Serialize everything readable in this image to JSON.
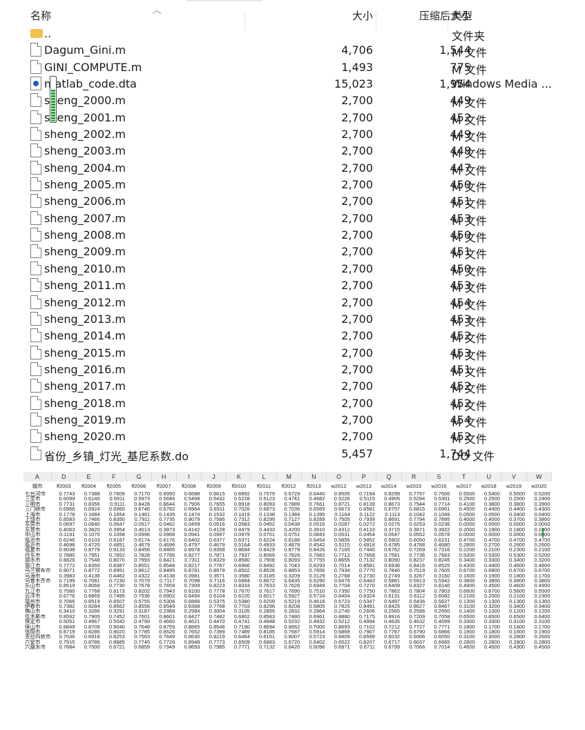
{
  "explorer": {
    "columns": {
      "name": "名称",
      "size": "大小",
      "compressed": "压缩后大小",
      "type": "类型"
    },
    "files": [
      {
        "name": "..",
        "size": "",
        "compressed": "",
        "type": "文件夹",
        "icon": "folder-icon"
      },
      {
        "name": "Dagum_Gini.m",
        "size": "4,706",
        "compressed": "1,544",
        "type": "M 文件",
        "icon": "document-icon"
      },
      {
        "name": "GINI_COMPUTE.m",
        "size": "1,493",
        "compressed": "775",
        "type": "M 文件",
        "icon": "document-icon"
      },
      {
        "name": "matlab_code.dta",
        "size": "15,023",
        "compressed": "1,954",
        "type": "Windows Media ...",
        "icon": "dta-file-icon"
      },
      {
        "name": "sheng_2000.m",
        "size": "2,700",
        "compressed": "449",
        "type": "M 文件",
        "icon": "document-icon"
      },
      {
        "name": "sheng_2001.m",
        "size": "2,700",
        "compressed": "452",
        "type": "M 文件",
        "icon": "document-icon"
      },
      {
        "name": "sheng_2002.m",
        "size": "2,700",
        "compressed": "449",
        "type": "M 文件",
        "icon": "document-icon"
      },
      {
        "name": "sheng_2003.m",
        "size": "2,700",
        "compressed": "448",
        "type": "M 文件",
        "icon": "document-icon"
      },
      {
        "name": "sheng_2004.m",
        "size": "2,700",
        "compressed": "447",
        "type": "M 文件",
        "icon": "document-icon"
      },
      {
        "name": "sheng_2005.m",
        "size": "2,700",
        "compressed": "450",
        "type": "M 文件",
        "icon": "document-icon"
      },
      {
        "name": "sheng_2006.m",
        "size": "2,700",
        "compressed": "451",
        "type": "M 文件",
        "icon": "document-icon"
      },
      {
        "name": "sheng_2007.m",
        "size": "2,700",
        "compressed": "453",
        "type": "M 文件",
        "icon": "document-icon"
      },
      {
        "name": "sheng_2008.m",
        "size": "2,700",
        "compressed": "450",
        "type": "M 文件",
        "icon": "document-icon"
      },
      {
        "name": "sheng_2009.m",
        "size": "2,700",
        "compressed": "451",
        "type": "M 文件",
        "icon": "document-icon"
      },
      {
        "name": "sheng_2010.m",
        "size": "2,700",
        "compressed": "450",
        "type": "M 文件",
        "icon": "document-icon"
      },
      {
        "name": "sheng_2011.m",
        "size": "2,700",
        "compressed": "453",
        "type": "M 文件",
        "icon": "document-icon"
      },
      {
        "name": "sheng_2012.m",
        "size": "2,700",
        "compressed": "454",
        "type": "M 文件",
        "icon": "document-icon"
      },
      {
        "name": "sheng_2013.m",
        "size": "2,700",
        "compressed": "453",
        "type": "M 文件",
        "icon": "document-icon"
      },
      {
        "name": "sheng_2014.m",
        "size": "2,700",
        "compressed": "452",
        "type": "M 文件",
        "icon": "document-icon"
      },
      {
        "name": "sheng_2015.m",
        "size": "2,700",
        "compressed": "453",
        "type": "M 文件",
        "icon": "document-icon"
      },
      {
        "name": "sheng_2016.m",
        "size": "2,700",
        "compressed": "451",
        "type": "M 文件",
        "icon": "document-icon"
      },
      {
        "name": "sheng_2017.m",
        "size": "2,700",
        "compressed": "452",
        "type": "M 文件",
        "icon": "document-icon"
      },
      {
        "name": "sheng_2018.m",
        "size": "2,700",
        "compressed": "452",
        "type": "M 文件",
        "icon": "document-icon"
      },
      {
        "name": "sheng_2019.m",
        "size": "2,700",
        "compressed": "454",
        "type": "M 文件",
        "icon": "document-icon"
      },
      {
        "name": "sheng_2020.m",
        "size": "2,700",
        "compressed": "452",
        "type": "M 文件",
        "icon": "document-icon"
      },
      {
        "name": "省份_乡镇_灯光_基尼系数.do",
        "size": "5,457",
        "compressed": "1,744",
        "type": "DO 文件",
        "icon": "document-icon"
      }
    ]
  },
  "spreadsheet": {
    "column_letters": [
      "A",
      "D",
      "E",
      "F",
      "G",
      "H",
      "I",
      "J",
      "K",
      "L",
      "M",
      "N",
      "O",
      "P",
      "Q",
      "R",
      "S",
      "T",
      "U",
      "V",
      "W"
    ],
    "field_names": [
      "城市",
      "ff2003",
      "ff2004",
      "ff2005",
      "ff2006",
      "ff2007",
      "ff2008",
      "ff2009",
      "ff2010",
      "ff2011",
      "ff2012",
      "ff2013",
      "w2012",
      "w2013",
      "w2014",
      "w2015",
      "w2016",
      "w2017",
      "w2018",
      "w2019",
      "w2020"
    ],
    "rows": [
      [
        "七台河市",
        "0.7743",
        "0.7388",
        "0.7609",
        "0.7170",
        "0.6950",
        "0.6688",
        "0.6615",
        "0.6892",
        "0.7079",
        "0.6729",
        "0.6440",
        "0.8505",
        "0.7194",
        "0.8299",
        "0.7797",
        "0.7606",
        "0.5500",
        "0.5400",
        "0.5500",
        "0.5200"
      ],
      [
        "三亚市",
        "0.6099",
        "0.6140",
        "0.5911",
        "0.5973",
        "0.5646",
        "0.5468",
        "0.5432",
        "0.5228",
        "0.5123",
        "0.4741",
        "0.4682",
        "0.5226",
        "0.5115",
        "0.4905",
        "0.5294",
        "0.5301",
        "0.2500",
        "0.2500",
        "0.2500",
        "0.2400"
      ],
      [
        "三明市",
        "0.7731",
        "0.8356",
        "0.9111",
        "0.8428",
        "0.8644",
        "0.7906",
        "0.7655",
        "0.8918",
        "0.8093",
        "0.7889",
        "0.7661",
        "0.8721",
        "0.8139",
        "0.8673",
        "0.7544",
        "0.7714",
        "0.4100",
        "0.3800",
        "0.3800",
        "0.3900"
      ],
      [
        "三门峡市",
        "0.6966",
        "0.6924",
        "0.6960",
        "0.6746",
        "0.6782",
        "0.6964",
        "0.6911",
        "0.7026",
        "0.6873",
        "0.7036",
        "0.6565",
        "0.6673",
        "0.6581",
        "0.6757",
        "0.6815",
        "0.6901",
        "0.4500",
        "0.4400",
        "0.4400",
        "0.4300"
      ],
      [
        "上海市",
        "0.1778",
        "0.1684",
        "0.1654",
        "0.1461",
        "0.1435",
        "0.1474",
        "0.1532",
        "0.1419",
        "0.1338",
        "0.1384",
        "0.1395",
        "0.1164",
        "0.1122",
        "0.1113",
        "0.1042",
        "0.1049",
        "0.0500",
        "0.0500",
        "0.0400",
        "0.0400"
      ],
      [
        "上饶市",
        "0.8583",
        "0.7466",
        "0.8350",
        "0.7911",
        "0.7735",
        "0.8079",
        "0.7586",
        "0.7312",
        "0.8299",
        "0.7127",
        "0.8289",
        "0.7505",
        "0.7939",
        "0.8691",
        "0.7794",
        "0.7895",
        "0.4000",
        "0.4000",
        "0.3700",
        "0.3800"
      ],
      [
        "东莞市",
        "0.0697",
        "0.0640",
        "0.0647",
        "0.0517",
        "0.0462",
        "0.0459",
        "0.0516",
        "0.0583",
        "0.0452",
        "0.0438",
        "0.0516",
        "0.0287",
        "0.0272",
        "0.0275",
        "0.0253",
        "0.0236",
        "0.0000",
        "0.0000",
        "0.0000",
        "0.0000"
      ],
      [
        "东营市",
        "0.4063",
        "0.3820",
        "0.3954",
        "0.4013",
        "0.3873",
        "0.4142",
        "0.4128",
        "0.4479",
        "0.4433",
        "0.4200",
        "0.3910",
        "0.4312",
        "0.4133",
        "0.3715",
        "0.3871",
        "0.3922",
        "0.2000",
        "0.1900",
        "0.1800",
        "0.1800"
      ],
      [
        "中山市",
        "0.1191",
        "0.1070",
        "0.1058",
        "0.0996",
        "0.0968",
        "0.0941",
        "0.0997",
        "0.0979",
        "0.0701",
        "0.0751",
        "0.0843",
        "0.0531",
        "0.0454",
        "0.0547",
        "0.0552",
        "0.0578",
        "0.0000",
        "0.0000",
        "0.0000",
        "0.0000"
      ],
      [
        "临沧市",
        "0.6246",
        "0.6103",
        "0.6187",
        "0.6174",
        "0.6176",
        "0.6402",
        "0.6377",
        "0.6371",
        "0.6224",
        "0.6186",
        "0.6454",
        "0.5856",
        "0.5852",
        "0.5902",
        "0.6050",
        "0.6231",
        "0.4700",
        "0.4700",
        "0.4700",
        "0.4700"
      ],
      [
        "临沂市",
        "0.4698",
        "0.4720",
        "0.4851",
        "0.4679",
        "0.4696",
        "0.4797",
        "0.4679",
        "0.5164",
        "0.4933",
        "0.4878",
        "0.4542",
        "0.5115",
        "0.4918",
        "0.4785",
        "0.4788",
        "0.4680",
        "0.2800",
        "0.2700",
        "0.2600",
        "0.2600"
      ],
      [
        "临夏市",
        "0.9038",
        "0.8778",
        "0.9133",
        "0.8456",
        "0.8485",
        "0.8978",
        "0.8358",
        "0.8694",
        "0.8429",
        "0.8779",
        "0.8426",
        "0.7165",
        "0.7445",
        "0.6762",
        "0.7269",
        "0.7316",
        "0.2200",
        "0.2100",
        "0.2300",
        "0.2100"
      ],
      [
        "丹东市",
        "0.7880",
        "0.7951",
        "0.7852",
        "0.7828",
        "0.7785",
        "0.8277",
        "0.7871",
        "0.7937",
        "0.8069",
        "0.7826",
        "0.7682",
        "0.7712",
        "0.7658",
        "0.7581",
        "0.7736",
        "0.7663",
        "0.5300",
        "0.5300",
        "0.5300",
        "0.5200"
      ],
      [
        "丽水市",
        "0.8826",
        "0.7548",
        "0.8070",
        "0.7993",
        "0.8421",
        "0.7311",
        "0.8329",
        "0.8580",
        "0.7908",
        "0.8093",
        "0.7755",
        "0.8655",
        "0.7132",
        "0.8090",
        "0.8237",
        "0.8245",
        "0.3400",
        "0.3300",
        "0.3400",
        "0.3200"
      ],
      [
        "丽江市",
        "0.7772",
        "0.8350",
        "0.8387",
        "0.8551",
        "0.8548",
        "0.8217",
        "0.7787",
        "0.6966",
        "0.8492",
        "0.7043",
        "0.8293",
        "0.7014",
        "0.8581",
        "0.6936",
        "0.8416",
        "0.8525",
        "0.4300",
        "0.4400",
        "0.4600",
        "0.4800"
      ],
      [
        "乌兰察布市",
        "0.9071",
        "0.8772",
        "0.8951",
        "0.8612",
        "0.8485",
        "0.8781",
        "0.8979",
        "0.8502",
        "0.8526",
        "0.8853",
        "0.7656",
        "0.7934",
        "0.7770",
        "0.7846",
        "0.7519",
        "0.7605",
        "0.6700",
        "0.6800",
        "0.6700",
        "0.6700"
      ],
      [
        "乌海市",
        "0.3983",
        "0.4136",
        "0.4462",
        "0.4322",
        "0.4138",
        "0.3981",
        "0.3571",
        "0.3580",
        "0.3185",
        "0.3209",
        "0.3129",
        "0.2768",
        "0.2730",
        "0.2749",
        "0.3267",
        "0.3160",
        "0.1600",
        "0.1900",
        "0.1800",
        "0.1700"
      ],
      [
        "乌鲁木齐市",
        "0.7199",
        "0.7081",
        "0.7230",
        "0.7079",
        "0.7117",
        "0.7098",
        "0.7116",
        "0.6884",
        "0.6672",
        "0.6435",
        "0.6290",
        "0.6479",
        "0.6443",
        "0.5881",
        "0.5913",
        "0.5942",
        "0.3800",
        "0.3800",
        "0.3800",
        "0.3800"
      ],
      [
        "乐山市",
        "0.8519",
        "0.8069",
        "0.7730",
        "0.7678",
        "0.7659",
        "0.7309",
        "0.8223",
        "0.8333",
        "0.7633",
        "0.7626",
        "0.6949",
        "0.7704",
        "0.7270",
        "0.6409",
        "0.8327",
        "0.8140",
        "0.4900",
        "0.4500",
        "0.4600",
        "0.4900"
      ],
      [
        "九江市",
        "0.7560",
        "0.7768",
        "0.8173",
        "0.8202",
        "0.7943",
        "0.8100",
        "0.7778",
        "0.7670",
        "0.7617",
        "0.7690",
        "0.7510",
        "0.7350",
        "0.7750",
        "0.7862",
        "0.7804",
        "0.7803",
        "0.6600",
        "0.6700",
        "0.5600",
        "0.5500"
      ],
      [
        "云浮市",
        "0.6776",
        "0.6869",
        "0.7495",
        "0.7536",
        "0.6902",
        "0.6494",
        "0.6104",
        "0.6220",
        "0.6017",
        "0.5927",
        "0.5724",
        "0.6404",
        "0.6324",
        "0.6131",
        "0.6112",
        "0.6082",
        "0.2100",
        "0.2000",
        "0.2100",
        "0.2300"
      ],
      [
        "亳州市",
        "0.7066",
        "0.6519",
        "0.6507",
        "0.5755",
        "0.5306",
        "0.6866",
        "0.5375",
        "0.5380",
        "0.5209",
        "0.5219",
        "0.4618",
        "0.5723",
        "0.5347",
        "0.5497",
        "0.5436",
        "0.5627",
        "0.1300",
        "0.1300",
        "0.1300",
        "0.1300"
      ],
      [
        "伊春市",
        "0.7382",
        "0.8284",
        "0.8562",
        "0.8556",
        "0.8549",
        "0.8368",
        "0.7768",
        "0.7703",
        "0.8296",
        "0.8208",
        "0.6805",
        "0.7825",
        "0.8491",
        "0.8425",
        "0.8627",
        "0.8467",
        "0.3100",
        "0.3200",
        "0.3400",
        "0.3400"
      ],
      [
        "佛山市",
        "0.3410",
        "0.3286",
        "0.3291",
        "0.3187",
        "0.2968",
        "0.2994",
        "0.3004",
        "0.3105",
        "0.2855",
        "0.2832",
        "0.2864",
        "0.2740",
        "0.2606",
        "0.2565",
        "0.2596",
        "0.2650",
        "0.1400",
        "0.1300",
        "0.1200",
        "0.1200"
      ],
      [
        "佳木斯市",
        "0.8592",
        "0.7905",
        "0.7452",
        "0.7601",
        "0.8601",
        "0.8427",
        "0.7482",
        "0.6802",
        "0.8583",
        "0.7480",
        "0.6961",
        "0.8880",
        "0.7175",
        "0.8916",
        "0.7209",
        "0.7058",
        "0.6500",
        "0.6500",
        "0.6500",
        "0.6400"
      ],
      [
        "保定市",
        "0.5051",
        "0.4967",
        "0.5042",
        "0.4790",
        "0.4660",
        "0.4621",
        "0.4470",
        "0.4741",
        "0.4948",
        "0.5232",
        "0.4832",
        "0.5212",
        "0.4994",
        "0.4635",
        "0.4632",
        "0.4699",
        "0.3300",
        "0.3300",
        "0.3100",
        "0.3100"
      ],
      [
        "保山市",
        "0.8849",
        "0.8709",
        "0.9040",
        "0.7648",
        "0.8759",
        "0.8865",
        "0.8546",
        "0.7190",
        "0.8694",
        "0.8662",
        "0.7000",
        "0.8693",
        "0.7102",
        "0.7212",
        "0.7727",
        "0.7771",
        "0.1800",
        "0.1700",
        "0.1600",
        "0.1700"
      ],
      [
        "信阳市",
        "0.8719",
        "0.8286",
        "0.8020",
        "0.7785",
        "0.8526",
        "0.7652",
        "0.7399",
        "0.7489",
        "0.8185",
        "0.7687",
        "0.5914",
        "0.6869",
        "0.7907",
        "0.7787",
        "0.6790",
        "0.6866",
        "0.1900",
        "0.1800",
        "0.1600",
        "0.1900"
      ],
      [
        "克拉玛依市",
        "0.7036",
        "0.6918",
        "0.8253",
        "0.7563",
        "0.7649",
        "0.6630",
        "0.8219",
        "0.6464",
        "0.6151",
        "0.6007",
        "0.5723",
        "0.8409",
        "0.6599",
        "0.6032",
        "0.6006",
        "0.6050",
        "0.3100",
        "0.3000",
        "0.2800",
        "0.2600"
      ],
      [
        "六安市",
        "0.7915",
        "0.8786",
        "0.8885",
        "0.7745",
        "0.7726",
        "0.8948",
        "0.7773",
        "0.6509",
        "0.6883",
        "0.6720",
        "0.6402",
        "0.6522",
        "0.8207",
        "0.6717",
        "0.6637",
        "0.6665",
        "0.2800",
        "0.2800",
        "0.2800",
        "0.2800"
      ],
      [
        "六盘水市",
        "0.7684",
        "0.7500",
        "0.6721",
        "0.6859",
        "0.7949",
        "0.8693",
        "0.7985",
        "0.7771",
        "0.7132",
        "0.8420",
        "0.6096",
        "0.6971",
        "0.6711",
        "0.6799",
        "0.7066",
        "0.7014",
        "0.4600",
        "0.4500",
        "0.4300",
        "0.4500"
      ]
    ]
  }
}
